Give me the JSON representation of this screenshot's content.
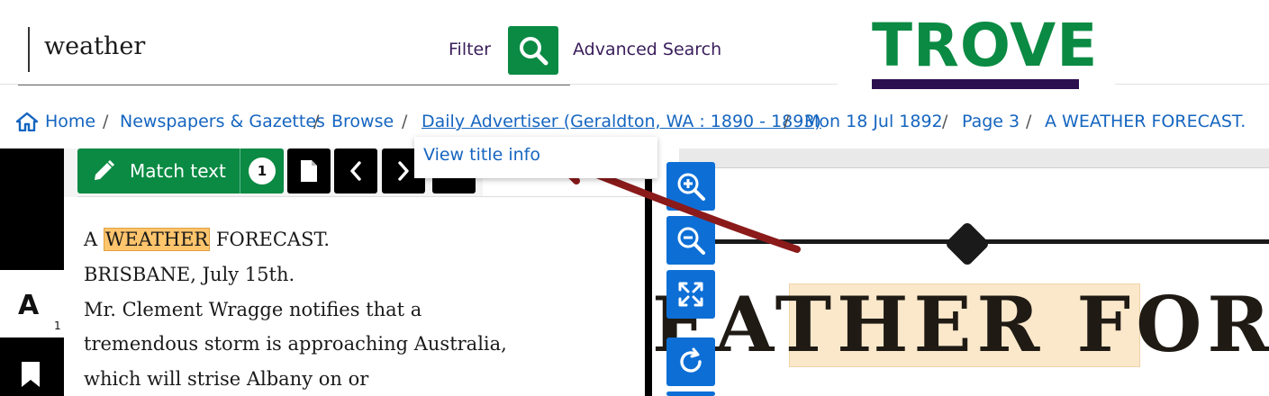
{
  "header": {
    "search_value": "weather",
    "filter_label": "Filter",
    "advanced_search_label": "Advanced Search",
    "logo_text": "TROVE"
  },
  "breadcrumb": {
    "items": [
      {
        "label": "Home"
      },
      {
        "label": "Newspapers & Gazettes"
      },
      {
        "label": "Browse"
      },
      {
        "label": "Daily Advertiser (Geraldton, WA : 1890 - 1893)"
      },
      {
        "label": "Mon 18 Jul 1892"
      },
      {
        "label": "Page 3"
      },
      {
        "label": "A WEATHER FORECAST."
      }
    ],
    "separator": "/"
  },
  "dropdown": {
    "item": "View title info"
  },
  "sidebar": {
    "font_glyph": "A",
    "font_count": "1"
  },
  "toolbar": {
    "match_text_label": "Match text",
    "match_count": "1"
  },
  "article": {
    "line1_before": "A ",
    "line1_highlight": "WEATHER",
    "line1_after": " FORECAST.",
    "lines": [
      "BRISBANE, July 15th.",
      "Mr. Clement Wragge notifies that a",
      "tremendous storm is approaching Australia,",
      "which will strise Albany on or"
    ]
  },
  "viewer": {
    "scan_text": "EATHER FORE"
  },
  "colors": {
    "brand_green": "#0a8a43",
    "brand_purple": "#2c0f4f",
    "link_blue": "#1565c0",
    "viewer_button_blue": "#0d6fd6",
    "highlight": "#ffc56d"
  },
  "icons": [
    "search-icon",
    "home-icon",
    "pencil-icon",
    "page-icon",
    "chevron-left-icon",
    "chevron-right-icon",
    "zoom-in-icon",
    "zoom-out-icon",
    "fullscreen-icon",
    "rotate-icon",
    "bookmark-icon"
  ]
}
